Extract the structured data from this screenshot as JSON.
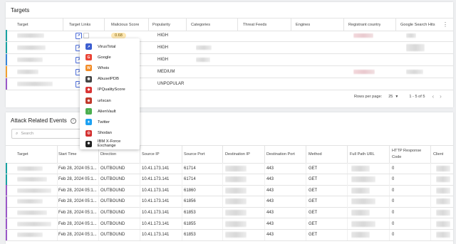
{
  "targets": {
    "title": "Targets",
    "columns": [
      "Target",
      "Target Links",
      "Malicious Score",
      "Popularity",
      "Categories",
      "Threat Feeds",
      "Engines",
      "Registrant country",
      "Google Search Hits"
    ],
    "rows": [
      {
        "bar": "#1aa3a3",
        "score": "0.68",
        "popularity": "HIGH"
      },
      {
        "bar": "#1aa3a3",
        "score": "",
        "popularity": "HIGH"
      },
      {
        "bar": "#3a86d8",
        "score": "",
        "popularity": "HIGH"
      },
      {
        "bar": "#f0a030",
        "score": "",
        "popularity": "MEDIUM"
      },
      {
        "bar": "#9b59c8",
        "score": "",
        "popularity": "UNPOPULAR"
      }
    ],
    "pagination": {
      "rows_per_page_label": "Rows per page:",
      "rows_per_page": "25",
      "range": "1 - 5 of 5"
    }
  },
  "link_menu": {
    "items": [
      {
        "label": "VirusTotal",
        "icon": "virustotal-icon",
        "color": "#3d5fd0"
      },
      {
        "label": "Google",
        "icon": "google-icon",
        "color": "#ea4335"
      },
      {
        "label": "Whois",
        "icon": "whois-icon",
        "color": "#f28c28"
      },
      {
        "label": "AbuseIPDB",
        "icon": "abuseipdb-icon",
        "color": "#444444"
      },
      {
        "label": "IPQualityScore",
        "icon": "ipqualityscore-icon",
        "color": "#d93636"
      },
      {
        "label": "urlscan",
        "icon": "urlscan-icon",
        "color": "#c0392b"
      },
      {
        "label": "AlienVault",
        "icon": "alienvault-icon",
        "color": "#4caf50"
      },
      {
        "label": "Twitter",
        "icon": "twitter-icon",
        "color": "#1da1f2"
      },
      {
        "label": "Shodan",
        "icon": "shodan-icon",
        "color": "#d32f2f"
      },
      {
        "label": "IBM X-Force Exchange",
        "icon": "ibm-xforce-icon",
        "color": "#222222"
      }
    ]
  },
  "events": {
    "title": "Attack Related Events",
    "search_placeholder": "Search",
    "columns": [
      "Target",
      "Start Time",
      "Direction",
      "Source IP",
      "Source Port",
      "Destination IP",
      "Destination Port",
      "Method",
      "Full Path URL",
      "HTTP Response Code",
      "Client"
    ],
    "rows": [
      {
        "bar": "#1aa3a3",
        "start": "Feb 28, 2024 05:1...",
        "direction": "OUTBOUND",
        "src_ip": "10.41.173.141",
        "src_port": "61714",
        "dst_port": "443",
        "method": "GET",
        "code": "0"
      },
      {
        "bar": "#1aa3a3",
        "start": "Feb 28, 2024 05:1...",
        "direction": "OUTBOUND",
        "src_ip": "10.41.173.141",
        "src_port": "61714",
        "dst_port": "443",
        "method": "GET",
        "code": "0"
      },
      {
        "bar": "#9b59c8",
        "start": "Feb 28, 2024 05:1...",
        "direction": "OUTBOUND",
        "src_ip": "10.41.173.141",
        "src_port": "61860",
        "dst_port": "443",
        "method": "GET",
        "code": "0"
      },
      {
        "bar": "#9b59c8",
        "start": "Feb 28, 2024 05:1...",
        "direction": "OUTBOUND",
        "src_ip": "10.41.173.141",
        "src_port": "61856",
        "dst_port": "443",
        "method": "GET",
        "code": "0"
      },
      {
        "bar": "#9b59c8",
        "start": "Feb 28, 2024 05:1...",
        "direction": "OUTBOUND",
        "src_ip": "10.41.173.141",
        "src_port": "61853",
        "dst_port": "443",
        "method": "GET",
        "code": "0"
      },
      {
        "bar": "#9b59c8",
        "start": "Feb 28, 2024 05:1...",
        "direction": "OUTBOUND",
        "src_ip": "10.41.173.141",
        "src_port": "61855",
        "dst_port": "443",
        "method": "GET",
        "code": "0"
      },
      {
        "bar": "#9b59c8",
        "start": "Feb 28, 2024 05:1...",
        "direction": "OUTBOUND",
        "src_ip": "10.41.173.141",
        "src_port": "61853",
        "dst_port": "443",
        "method": "GET",
        "code": "0"
      }
    ]
  }
}
